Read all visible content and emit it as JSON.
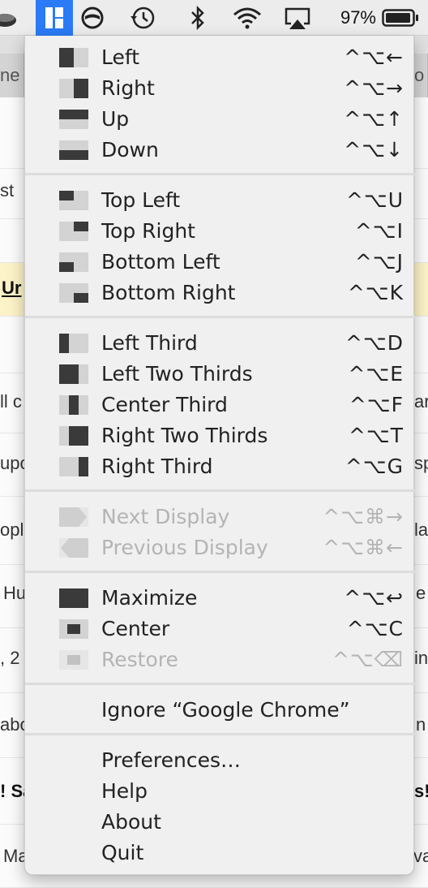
{
  "menubar": {
    "battery_percent": "97%",
    "icons": [
      "app-icon",
      "rectangle-layout-icon",
      "no-entry-circle-icon",
      "time-machine-icon",
      "bluetooth-icon",
      "wifi-icon",
      "airplay-icon",
      "battery-icon"
    ],
    "active_color": "#2a7bf5"
  },
  "background": {
    "fragments": {
      "r1_left": "ne",
      "r1_right": "o",
      "r2_left": "st",
      "r3_left": "Ur",
      "r4_left": "ll c",
      "r4_right": "ar",
      "r5_left": "upo",
      "r5_right": "sp",
      "r6_left": "opl",
      "r6_right": "la",
      "r7_left": "Hu",
      "r7_right": "e",
      "r8_left": ", 2",
      "r8_right": "in",
      "r9_left": "abo",
      "r9_right": "n",
      "r10_left": "! Sa",
      "r10_right": "s!",
      "r11_left": "Ma",
      "r11_right": "va"
    }
  },
  "menu": {
    "groups": [
      [
        {
          "label": "Left",
          "shortcut": "^⌥←",
          "icon": "snap-left-icon"
        },
        {
          "label": "Right",
          "shortcut": "^⌥→",
          "icon": "snap-right-icon"
        },
        {
          "label": "Up",
          "shortcut": "^⌥↑",
          "icon": "snap-up-icon"
        },
        {
          "label": "Down",
          "shortcut": "^⌥↓",
          "icon": "snap-down-icon"
        }
      ],
      [
        {
          "label": "Top Left",
          "shortcut": "^⌥U",
          "icon": "top-left-icon"
        },
        {
          "label": "Top Right",
          "shortcut": "^⌥I",
          "icon": "top-right-icon"
        },
        {
          "label": "Bottom Left",
          "shortcut": "^⌥J",
          "icon": "bottom-left-icon"
        },
        {
          "label": "Bottom Right",
          "shortcut": "^⌥K",
          "icon": "bottom-right-icon"
        }
      ],
      [
        {
          "label": "Left Third",
          "shortcut": "^⌥D",
          "icon": "left-third-icon"
        },
        {
          "label": "Left Two Thirds",
          "shortcut": "^⌥E",
          "icon": "left-two-thirds-icon"
        },
        {
          "label": "Center Third",
          "shortcut": "^⌥F",
          "icon": "center-third-icon"
        },
        {
          "label": "Right Two Thirds",
          "shortcut": "^⌥T",
          "icon": "right-two-thirds-icon"
        },
        {
          "label": "Right Third",
          "shortcut": "^⌥G",
          "icon": "right-third-icon"
        }
      ],
      [
        {
          "label": "Next Display",
          "shortcut": "^⌥⌘→",
          "icon": "next-display-icon",
          "disabled": true
        },
        {
          "label": "Previous Display",
          "shortcut": "^⌥⌘←",
          "icon": "previous-display-icon",
          "disabled": true
        }
      ],
      [
        {
          "label": "Maximize",
          "shortcut": "^⌥↩",
          "icon": "maximize-icon"
        },
        {
          "label": "Center",
          "shortcut": "^⌥C",
          "icon": "center-icon"
        },
        {
          "label": "Restore",
          "shortcut": "^⌥⌫",
          "icon": "restore-icon",
          "disabled": true
        }
      ],
      [
        {
          "label": "Ignore “Google Chrome”",
          "shortcut": "",
          "icon": ""
        }
      ],
      [
        {
          "label": "Preferences…",
          "shortcut": "",
          "icon": ""
        },
        {
          "label": "Help",
          "shortcut": "",
          "icon": ""
        },
        {
          "label": "About",
          "shortcut": "",
          "icon": ""
        },
        {
          "label": "Quit",
          "shortcut": "",
          "icon": ""
        }
      ]
    ]
  }
}
